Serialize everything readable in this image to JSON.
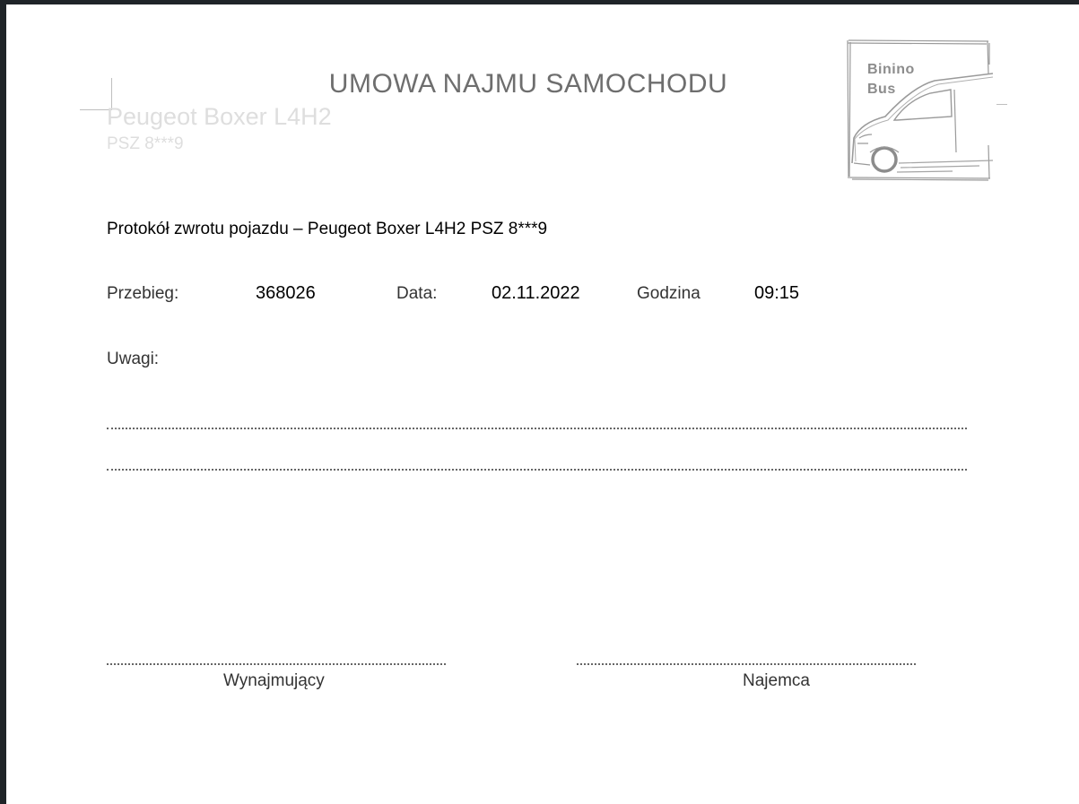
{
  "header": {
    "title": "UMOWA NAJMU SAMOCHODU",
    "vehicle_model": "Peugeot Boxer L4H2",
    "vehicle_plate": "PSZ 8***9"
  },
  "logo": {
    "line1": "Binino",
    "line2": "Bus",
    "color": "#8c8c8c"
  },
  "protocol": {
    "heading": "Protokół zwrotu pojazdu – Peugeot Boxer L4H2 PSZ 8***9"
  },
  "fields": {
    "mileage_label": "Przebieg:",
    "mileage_value": "368026",
    "date_label": "Data:",
    "date_value": "02.11.2022",
    "time_label": "Godzina",
    "time_value": "09:15"
  },
  "notes": {
    "label": "Uwagi:"
  },
  "signatures": {
    "lessor": "Wynajmujący",
    "lessee": "Najemca"
  }
}
